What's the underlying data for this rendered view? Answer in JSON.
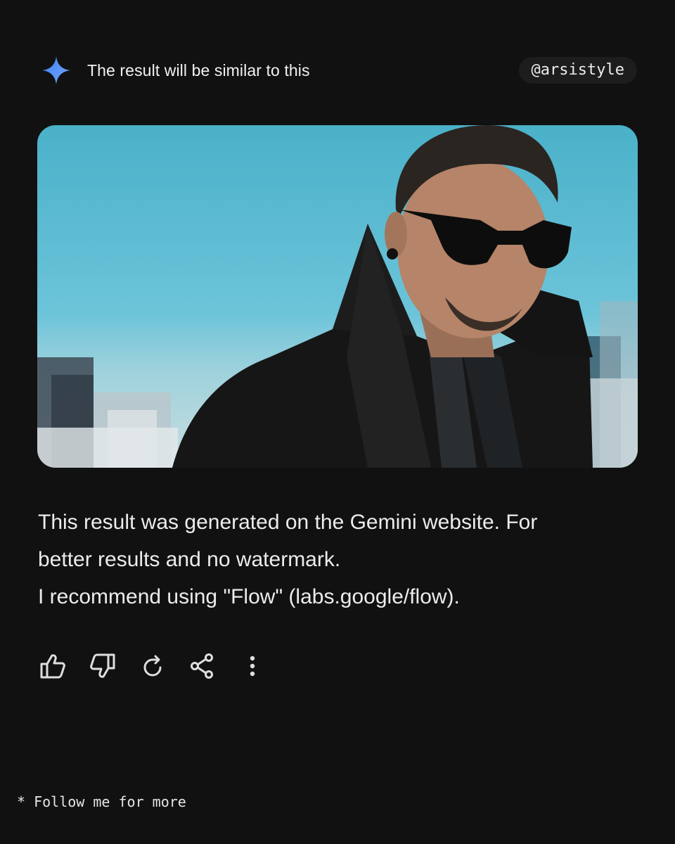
{
  "header": {
    "title": "The result will be similar to this",
    "handle": "@arsistyle",
    "icon": "gemini-sparkle-icon",
    "accent_color": "#4f8df5"
  },
  "image": {
    "subject": "photo"
  },
  "message": {
    "line1": "This result was generated on the Gemini website. For",
    "line2": "better results and no watermark.",
    "line3": "I recommend using \"Flow\" (labs.google/flow)."
  },
  "actions": [
    {
      "icon": "thumbs-up-icon"
    },
    {
      "icon": "thumbs-down-icon"
    },
    {
      "icon": "regenerate-icon"
    },
    {
      "icon": "share-icon"
    },
    {
      "icon": "more-options-icon"
    }
  ],
  "footer": {
    "text": "* Follow me for more"
  }
}
